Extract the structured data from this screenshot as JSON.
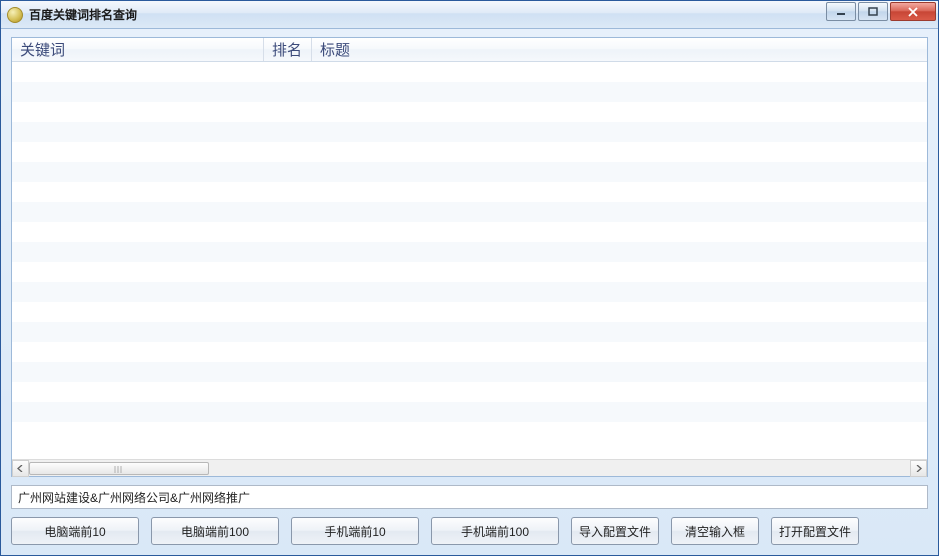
{
  "window": {
    "title": "百度关键词排名查询"
  },
  "listview": {
    "columns": {
      "c1": "关键词",
      "c2": "排名",
      "c3": "标题"
    }
  },
  "input": {
    "value": "广州网站建设&广州网络公司&广州网络推广"
  },
  "buttons": {
    "pc10": "电脑端前10",
    "pc100": "电脑端前100",
    "mob10": "手机端前10",
    "mob100": "手机端前100",
    "import": "导入配置文件",
    "clear": "清空输入框",
    "openconf": "打开配置文件"
  }
}
